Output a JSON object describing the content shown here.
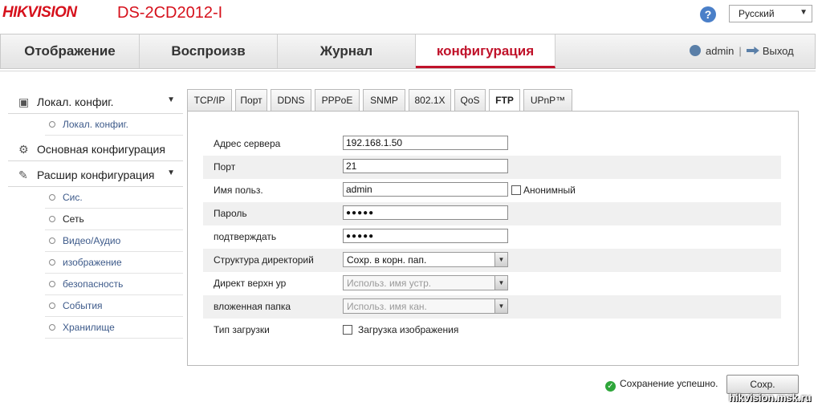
{
  "header": {
    "brand": "HIKVISION",
    "model": "DS-2CD2012-I",
    "help_glyph": "?",
    "language": "Русский"
  },
  "nav": {
    "tabs": [
      {
        "label": "Отображение"
      },
      {
        "label": "Воспроизв"
      },
      {
        "label": "Журнал"
      },
      {
        "label": "конфигурация"
      }
    ],
    "active_tab": 3,
    "user": "admin",
    "separator": "|",
    "logout": "Выход"
  },
  "sidebar": {
    "sections": [
      {
        "label": "Локал. конфиг.",
        "icon": "monitor-icon"
      },
      {
        "label": "Основная конфигурация",
        "icon": "gear-icon"
      },
      {
        "label": "Расшир конфигурация",
        "icon": "wrench-icon"
      }
    ],
    "local_items": [
      "Локал. конфиг."
    ],
    "advanced_items": [
      "Сис.",
      "Сеть",
      "Видео/Аудио",
      "изображение",
      "безопасность",
      "События",
      "Хранилище"
    ],
    "active_item": "Сеть"
  },
  "subtabs": [
    "TCP/IP",
    "Порт",
    "DDNS",
    "PPPoE",
    "SNMP",
    "802.1X",
    "QoS",
    "FTP",
    "UPnP™"
  ],
  "active_subtab": "FTP",
  "form": {
    "server_address": {
      "label": "Адрес сервера",
      "value": "192.168.1.50"
    },
    "port": {
      "label": "Порт",
      "value": "21"
    },
    "username": {
      "label": "Имя польз.",
      "value": "admin"
    },
    "anonymous": {
      "label": "Анонимный",
      "checked": false
    },
    "password": {
      "label": "Пароль",
      "value": "●●●●●"
    },
    "confirm": {
      "label": "подтверждать",
      "value": "●●●●●"
    },
    "dir_structure": {
      "label": "Структура директорий",
      "value": "Сохр. в корн. пап."
    },
    "parent_dir": {
      "label": "Директ верхн ур",
      "value": "Использ. имя устр."
    },
    "child_dir": {
      "label": "вложенная папка",
      "value": "Использ. имя кан."
    },
    "upload_type": {
      "label": "Тип загрузки",
      "option": "Загрузка изображения",
      "checked": false
    }
  },
  "footer": {
    "status": "Сохранение успешно.",
    "save_label": "Сохр.",
    "watermark": "hikvision.msk.ru"
  }
}
